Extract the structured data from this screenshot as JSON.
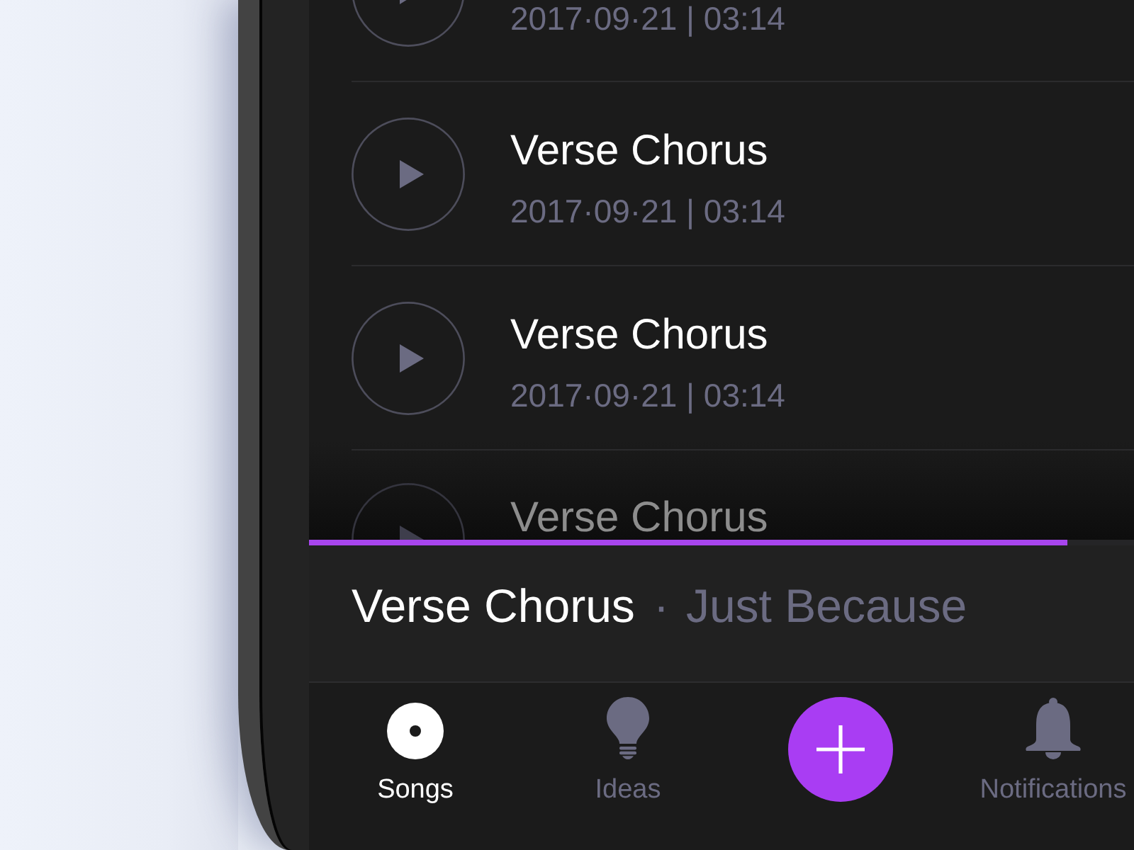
{
  "song_list": {
    "rows": [
      {
        "kind": "top_cut",
        "date": "2017·09·21 | 03:14"
      },
      {
        "kind": "full",
        "title": "Verse Chorus",
        "date": "2017·09·21 | 03:14"
      },
      {
        "kind": "full",
        "title": "Verse Chorus",
        "date": "2017·09·21 | 03:14"
      },
      {
        "kind": "bottom_cut",
        "title": "Verse Chorus"
      }
    ]
  },
  "player": {
    "progress": {
      "level": 0.92
    },
    "title": "Verse Chorus",
    "separator": "·",
    "artist": "Just Because"
  },
  "tab_bar": {
    "items": [
      {
        "kind": "tab",
        "label": "Songs",
        "selected": true
      },
      {
        "kind": "tab",
        "label": "Ideas",
        "selected": false
      },
      {
        "kind": "add",
        "selected": false
      },
      {
        "kind": "tab",
        "label": "Notifications",
        "selected": false
      }
    ]
  }
}
